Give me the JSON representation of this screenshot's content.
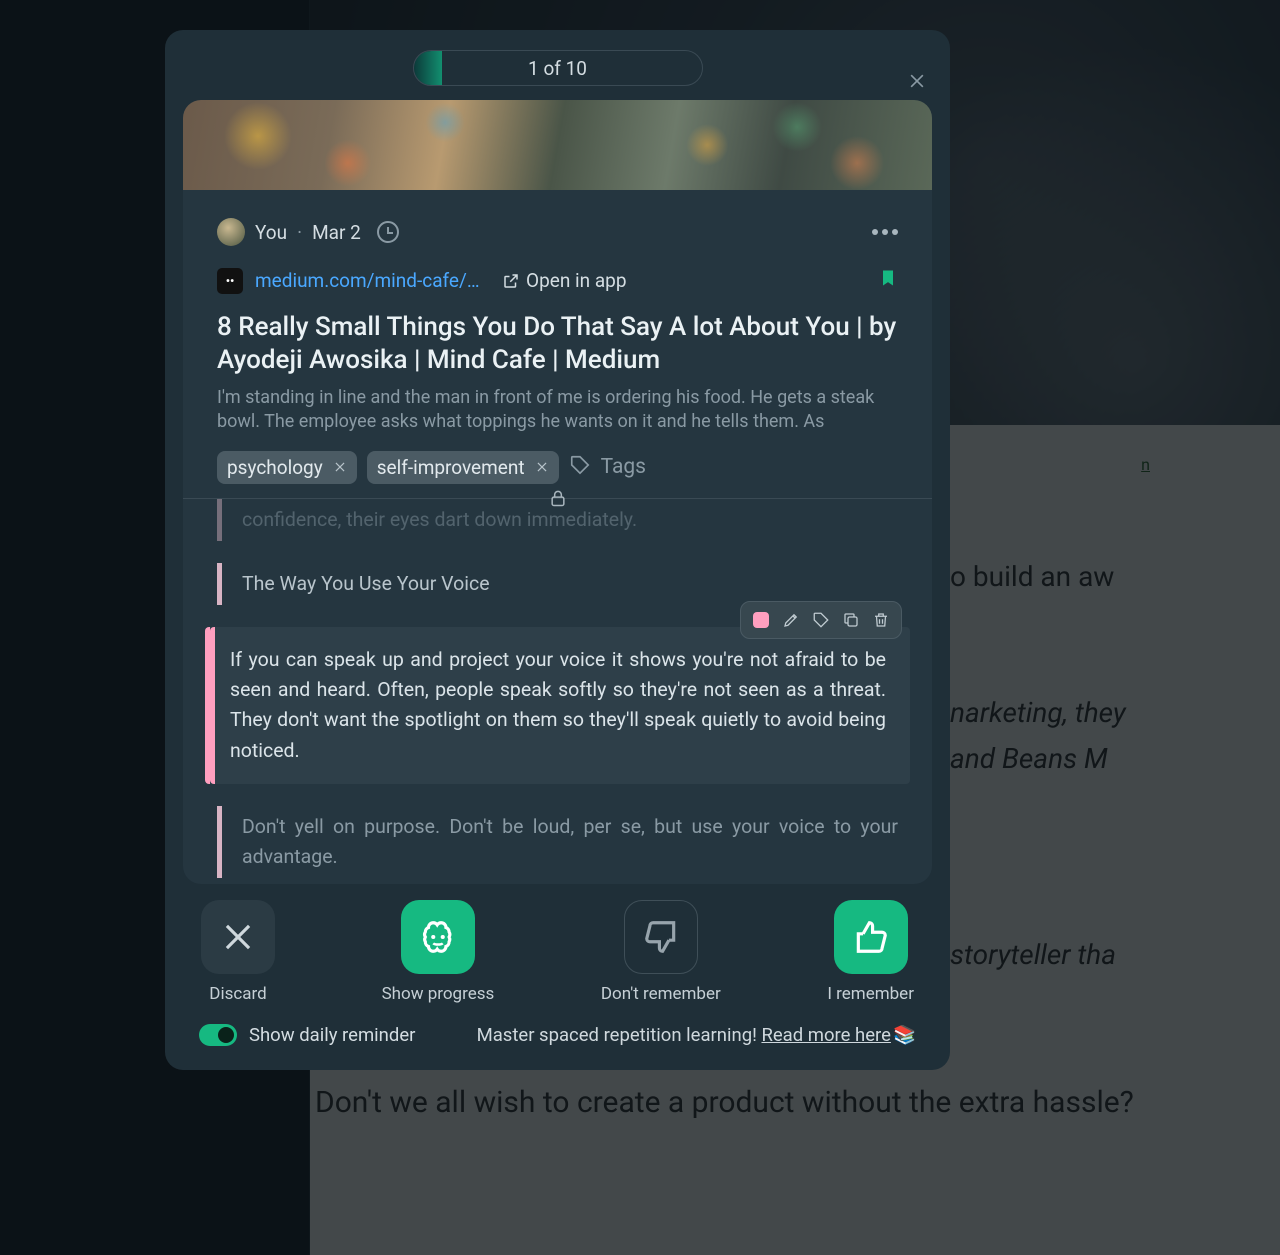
{
  "background": {
    "link_text": "n",
    "line1": "o build an aw",
    "line2": "narketing, they",
    "line3": " and Beans M",
    "line4": " storyteller tha",
    "line5": "Don't we all wish to create a product without the extra hassle?"
  },
  "modal": {
    "progress_label": "1 of 10",
    "meta": {
      "author": "You",
      "date": "Mar 2"
    },
    "source": {
      "favicon_letter": "••",
      "url": "medium.com/mind-cafe/8...",
      "open_in_app": "Open in app"
    },
    "title": "8 Really Small Things You Do That Say A lot About You | by Ayodeji Awosika | Mind Cafe | Medium",
    "excerpt": "I'm standing in line and the man in front of me is ordering his food. He gets a steak bowl. The employee asks what toppings he wants on it and he tells them. As",
    "tags": {
      "items": [
        "psychology",
        "self-improvement"
      ],
      "placeholder": "Tags"
    },
    "highlights": {
      "faded": "confidence, their eyes dart down immediately.",
      "h1": "The Way You Use Your Voice",
      "current": "If you can speak up and project your voice it shows you're not afraid to be seen and heard. Often, people speak softly so they're not seen as a threat. They don't want the spotlight on them so they'll speak quietly to avoid being noticed.",
      "h3": "Don't yell on purpose. Don't be loud, per se, but use your voice to your advantage."
    },
    "actions": {
      "discard": "Discard",
      "show_progress": "Show progress",
      "dont_remember": "Don't remember",
      "remember": "I remember"
    },
    "footer": {
      "reminder": "Show daily reminder",
      "promo_pre": "Master spaced repetition learning! ",
      "promo_link": "Read more here",
      "emoji": "📚"
    }
  }
}
